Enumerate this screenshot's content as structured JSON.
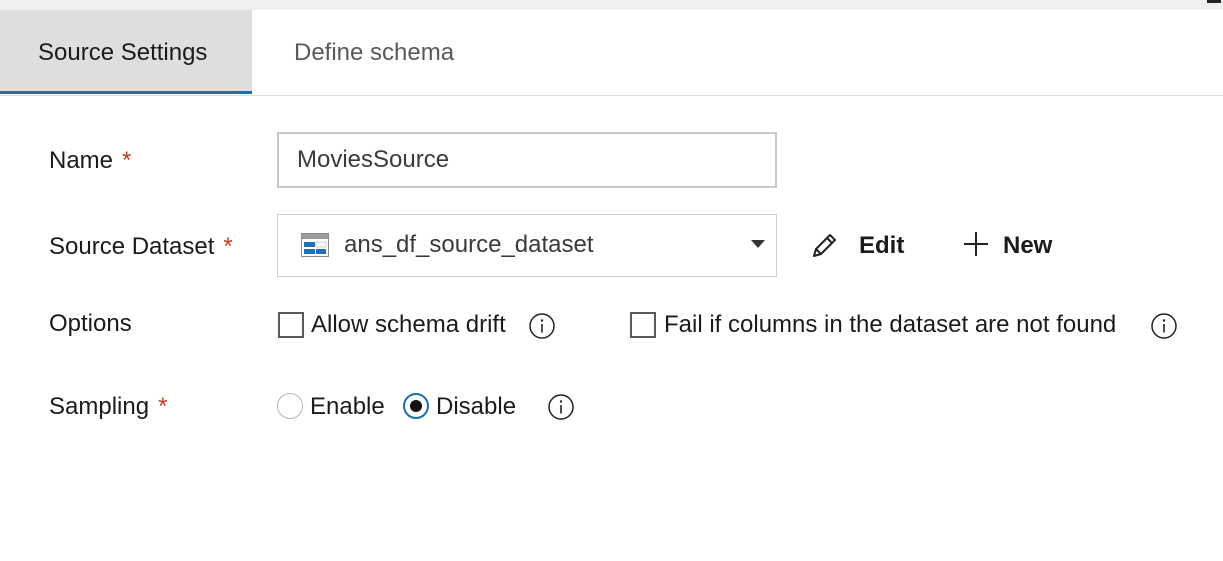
{
  "tabs": [
    {
      "label": "Source Settings",
      "active": true
    },
    {
      "label": "Define schema",
      "active": false
    }
  ],
  "form": {
    "name": {
      "label": "Name",
      "required_mark": "*",
      "value": "MoviesSource"
    },
    "source_dataset": {
      "label": "Source Dataset",
      "required_mark": "*",
      "value": "ans_df_source_dataset",
      "icon": "table-dataset-icon"
    },
    "edit_label": "Edit",
    "new_label": "New",
    "options": {
      "label": "Options",
      "allow_schema_drift": {
        "label": "Allow schema drift",
        "checked": false
      },
      "fail_if_columns_missing": {
        "label": "Fail if columns in the dataset are not found",
        "checked": false
      }
    },
    "sampling": {
      "label": "Sampling",
      "required_mark": "*",
      "enable_label": "Enable",
      "disable_label": "Disable",
      "selected": "Disable"
    }
  },
  "colors": {
    "accent": "#1b6fa8",
    "required": "#c23b22",
    "active_tab_bg": "#dedede"
  }
}
